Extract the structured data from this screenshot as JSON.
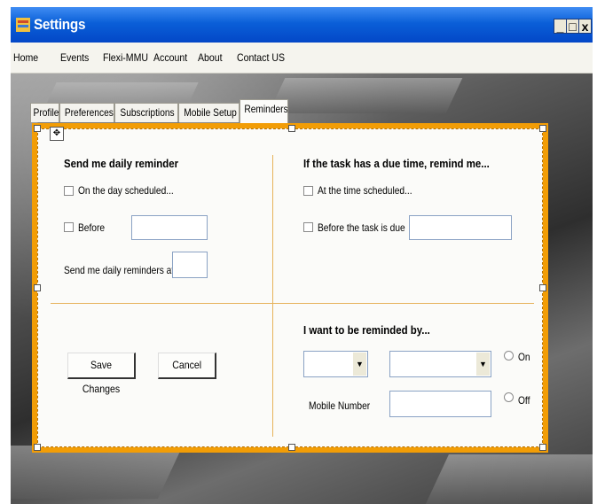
{
  "window": {
    "title": "Settings",
    "controls": {
      "minimize": "_",
      "maximize": "□",
      "close": "x"
    }
  },
  "menu": [
    "Home",
    "Events",
    "Flexi-MMU",
    "Account",
    "About",
    "Contact US"
  ],
  "tabs": [
    "Profile",
    "Preferences",
    "Subscriptions",
    "Mobile Setup",
    "Reminders"
  ],
  "active_tab": "Reminders",
  "daily": {
    "heading": "Send me daily reminder",
    "on_day_label": "On the day scheduled...",
    "before_label": "Before",
    "before_value": "",
    "time_label": "Send me daily reminders at",
    "time_value": ""
  },
  "due": {
    "heading": "If the task has a due time, remind me...",
    "at_time_label": "At the time scheduled...",
    "before_due_label": "Before the task is due",
    "before_due_value": ""
  },
  "remind_by": {
    "heading": "I want to be reminded by...",
    "combo1_value": "",
    "combo2_value": "",
    "on_label": "On",
    "off_label": "Off",
    "mobile_label": "Mobile Number",
    "mobile_value": ""
  },
  "actions": {
    "save": "Save Changes",
    "cancel": "Cancel"
  },
  "colors": {
    "title_bar": "#0a5fd8",
    "designer_border": "#f29d06",
    "divider": "#e6b25a"
  }
}
